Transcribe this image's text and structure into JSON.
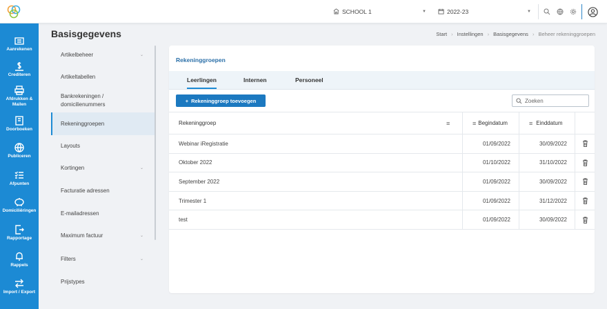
{
  "header": {
    "school": "SCHOOL 1",
    "year": "2022-23"
  },
  "colors": {
    "sidebar": "#1c8ad4",
    "primary_button": "#1c79c0",
    "link": "#2a6fa8"
  },
  "sidebar": {
    "items": [
      {
        "label": "Aanrekenen",
        "icon": "invoice-icon"
      },
      {
        "label": "Crediteren",
        "icon": "dollar-icon"
      },
      {
        "label": "Afdrukken & Mailen",
        "icon": "printer-icon"
      },
      {
        "label": "Doorboeken",
        "icon": "book-icon"
      },
      {
        "label": "Publiceren",
        "icon": "globe-icon"
      },
      {
        "label": "Afpunten",
        "icon": "checklist-icon"
      },
      {
        "label": "Domiciliëringen",
        "icon": "piggy-bank-icon"
      },
      {
        "label": "Rapportage",
        "icon": "report-icon"
      },
      {
        "label": "Rappels",
        "icon": "bell-icon"
      },
      {
        "label": "Import / Export",
        "icon": "transfer-icon"
      }
    ]
  },
  "page": {
    "title": "Basisgegevens",
    "breadcrumb": [
      "Start",
      "Instellingen",
      "Basisgegevens",
      "Beheer rekeninggroepen"
    ]
  },
  "subnav": {
    "items": [
      {
        "label": "Artikelbeheer",
        "expandable": true
      },
      {
        "label": "Artikeltabellen",
        "expandable": false
      },
      {
        "label": "Bankrekeningen / domicilienummers",
        "expandable": false
      },
      {
        "label": "Rekeninggroepen",
        "expandable": false,
        "active": true
      },
      {
        "label": "Layouts",
        "expandable": false
      },
      {
        "label": "Kortingen",
        "expandable": true
      },
      {
        "label": "Facturatie adressen",
        "expandable": false
      },
      {
        "label": "E-mailadressen",
        "expandable": false
      },
      {
        "label": "Maximum factuur",
        "expandable": true
      },
      {
        "label": "Filters",
        "expandable": true
      },
      {
        "label": "Prijstypes",
        "expandable": false
      }
    ]
  },
  "card": {
    "title": "Rekeninggroepen",
    "tabs": [
      "Leerlingen",
      "Internen",
      "Personeel"
    ],
    "active_tab": "Leerlingen",
    "add_button": "Rekeninggroep toevoegen",
    "search_placeholder": "Zoeken"
  },
  "table": {
    "columns": [
      "Rekeninggroep",
      "Begindatum",
      "Einddatum"
    ],
    "rows": [
      {
        "name": "Webinar iRegistratie",
        "begin": "01/09/2022",
        "end": "30/09/2022"
      },
      {
        "name": "Oktober 2022",
        "begin": "01/10/2022",
        "end": "31/10/2022"
      },
      {
        "name": "September 2022",
        "begin": "01/09/2022",
        "end": "30/09/2022"
      },
      {
        "name": "Trimester 1",
        "begin": "01/09/2022",
        "end": "31/12/2022"
      },
      {
        "name": "test",
        "begin": "01/09/2022",
        "end": "30/09/2022"
      }
    ]
  }
}
